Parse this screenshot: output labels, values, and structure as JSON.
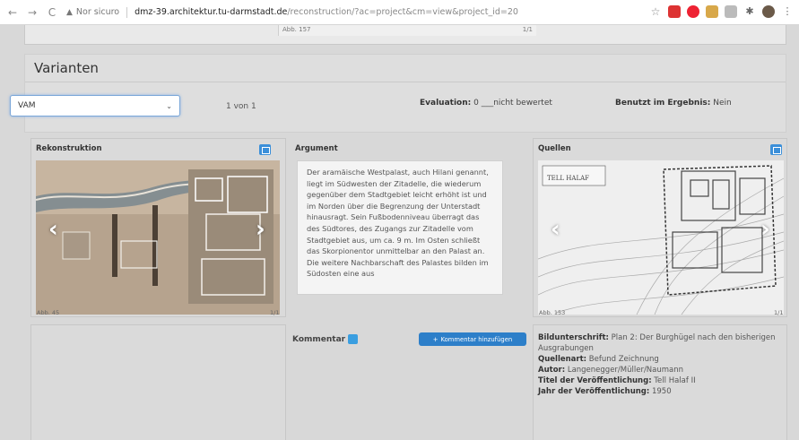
{
  "browser": {
    "back": "←",
    "forward": "→",
    "reload": "C",
    "warning": "▲",
    "insecure": "Nor sicuro",
    "host": "dmz-39.architektur.tu-darmstadt.de",
    "path": "/reconstruction/?ac=project&cm=view&project_id=20"
  },
  "top_caption": {
    "left": "Abb. 157",
    "right": "1/1"
  },
  "varianten": {
    "title": "Varianten",
    "select_value": "VAM",
    "count": "1 von 1",
    "evaluation_label": "Evaluation:",
    "evaluation_value": "0 ___nicht bewertet",
    "used_label": "Benutzt im Ergebnis:",
    "used_value": "Nein"
  },
  "rekonstruktion": {
    "title": "Rekonstruktion",
    "caption_left": "Abb. 45",
    "caption_right": "1/1"
  },
  "argument": {
    "title": "Argument",
    "text": "Der aramäische Westpalast, auch Hilani genannt, liegt im Südwesten der Zitadelle, die wiederum gegenüber dem Stadtgebiet leicht erhöht ist und im Norden über die Begrenzung der Unterstadt hinausragt. Sein Fußbodenniveau überragt das des Südtores, des Zugangs zur Zitadelle vom Stadtgebiet aus, um ca. 9 m. Im Osten schließt das Skorpionentor unmittelbar an den Palast an. Die weitere Nachbarschaft des Palastes bilden im Südosten eine aus"
  },
  "quellen": {
    "title": "Quellen",
    "plan_label": "TELL HALAF",
    "caption_left": "Abb. 153",
    "caption_right": "1/1"
  },
  "kommentar": {
    "label": "Kommentar",
    "add_button": "Kommentar hinzufügen",
    "add_icon": "+"
  },
  "meta": {
    "bild_label": "Bildunterschrift:",
    "bild_value": "Plan 2: Der Burghügel nach den bisherigen Ausgrabungen",
    "quelle_label": "Quellenart:",
    "quelle_value": "Befund Zeichnung",
    "autor_label": "Autor:",
    "autor_value": "Langenegger/Müller/Naumann",
    "titel_label": "Titel der Veröffentlichung:",
    "titel_value": "Tell Halaf II",
    "jahr_label": "Jahr der Veröffentlichung:",
    "jahr_value": "1950"
  },
  "colors": {
    "accent": "#2d7fc9",
    "badge": "#3a9ee0"
  }
}
